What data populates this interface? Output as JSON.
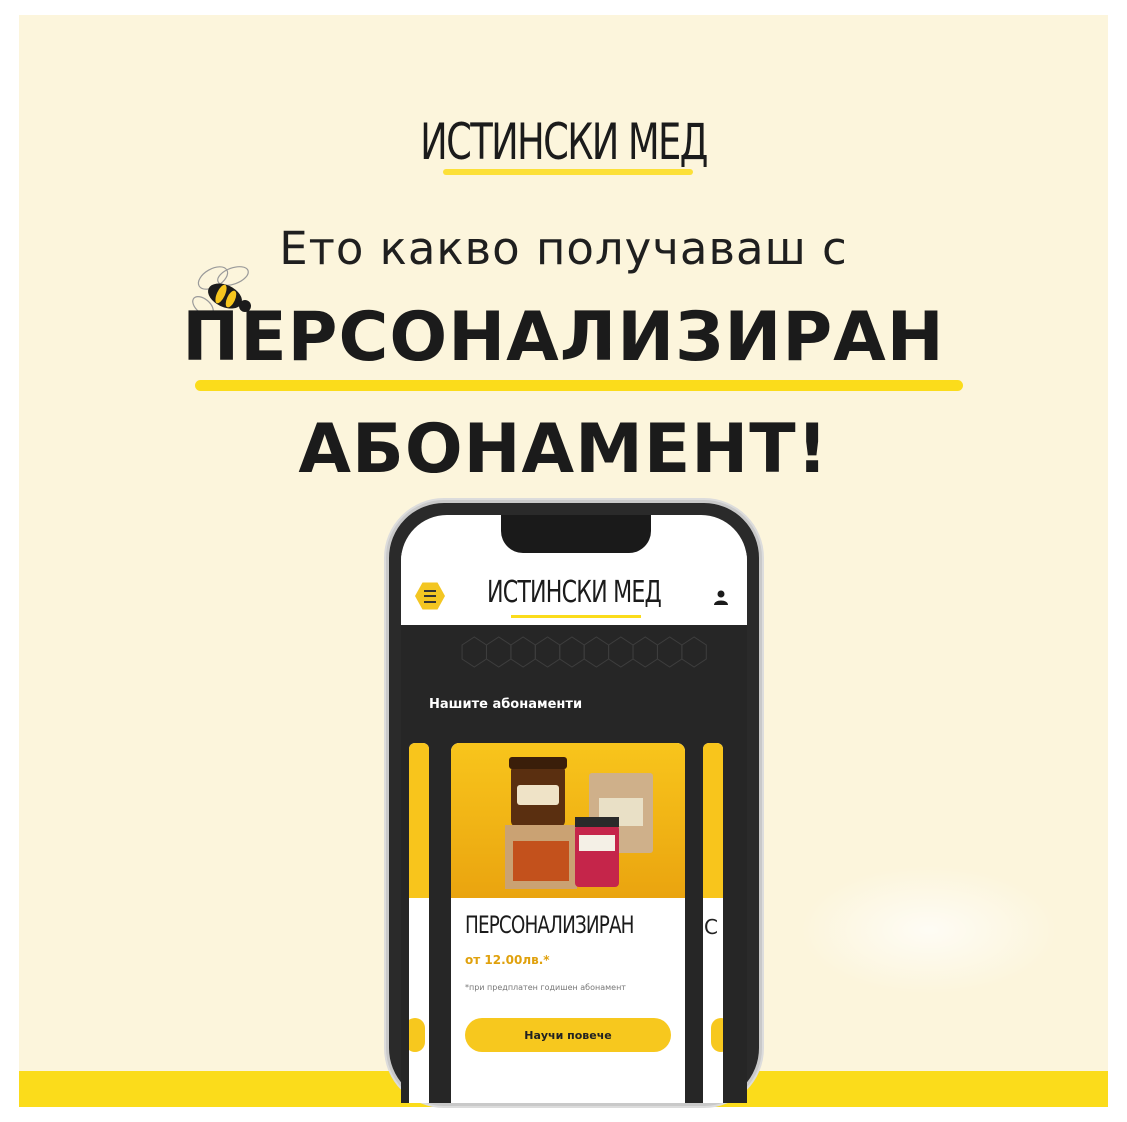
{
  "brand": {
    "logo": "ИСТИНСКИ МЕД"
  },
  "headline": {
    "intro": "Ето какво получаваш с",
    "line1": "ПЕРСОНАЛИЗИРАН",
    "line2": "АБОНАМЕНТ!"
  },
  "app": {
    "logo": "ИСТИНСКИ МЕД",
    "section_title": "Нашите абонаменти",
    "card": {
      "name": "ПЕРСОНАЛИЗИРАН",
      "price": "от 12.00лв.*",
      "note": "*при предплатен годишен абонамент",
      "button": "Научи повече"
    },
    "next_card_letter": "С"
  },
  "colors": {
    "accent": "#fbdc1b",
    "background": "#fcf5dc",
    "dark": "#262626",
    "price": "#e0a10d"
  },
  "icons": [
    "bee-icon",
    "menu-icon",
    "user-icon",
    "product-photo"
  ]
}
